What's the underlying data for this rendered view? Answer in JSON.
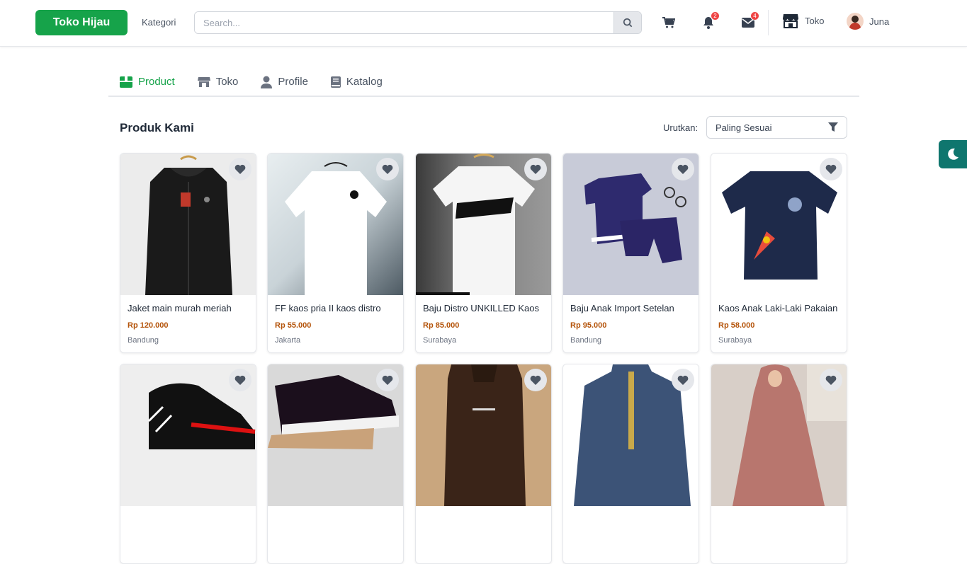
{
  "header": {
    "brand": "Toko Hijau",
    "category_label": "Kategori",
    "search_placeholder": "Search...",
    "notifications_count": "2",
    "messages_count": "4",
    "store_label": "Toko",
    "user_name": "Juna"
  },
  "tabs": [
    {
      "label": "Product",
      "icon": "box-icon",
      "active": true
    },
    {
      "label": "Toko",
      "icon": "store-icon",
      "active": false
    },
    {
      "label": "Profile",
      "icon": "user-icon",
      "active": false
    },
    {
      "label": "Katalog",
      "icon": "book-icon",
      "active": false
    }
  ],
  "section": {
    "title": "Produk Kami",
    "sort_label": "Urutkan:",
    "sort_value": "Paling Sesuai"
  },
  "products": [
    {
      "name": "Jaket main murah meriah",
      "price": "Rp 120.000",
      "city": "Bandung",
      "image": "black-hoodie"
    },
    {
      "name": "FF kaos pria II kaos distro",
      "price": "Rp 55.000",
      "city": "Jakarta",
      "image": "white-tshirt"
    },
    {
      "name": "Baju Distro UNKILLED Kaos",
      "price": "Rp 85.000",
      "city": "Surabaya",
      "image": "white-tshirt-unkilled"
    },
    {
      "name": "Baju Anak Import Setelan",
      "price": "Rp 95.000",
      "city": "Bandung",
      "image": "kids-navy-set"
    },
    {
      "name": "Kaos Anak Laki-Laki Pakaian",
      "price": "Rp 58.000",
      "city": "Surabaya",
      "image": "kids-navy-tshirt"
    },
    {
      "image": "black-sneaker"
    },
    {
      "image": "black-canvas-shoe"
    },
    {
      "image": "brown-hoodie"
    },
    {
      "image": "blue-koko-shirt"
    },
    {
      "image": "pink-hijab-dress"
    }
  ],
  "colors": {
    "brand": "#16a34a",
    "price": "#b45309",
    "badge": "#ef4444",
    "theme_toggle": "#0f766e"
  }
}
